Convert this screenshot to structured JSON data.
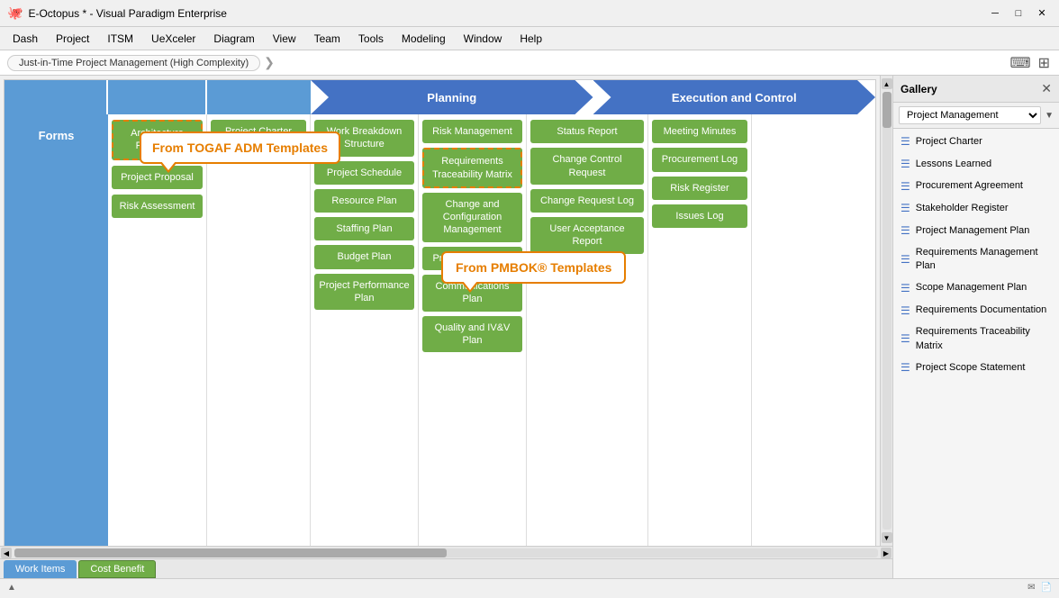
{
  "titleBar": {
    "title": "E-Octopus * - Visual Paradigm Enterprise",
    "icon": "🐙"
  },
  "menuBar": {
    "items": [
      "Dash",
      "Project",
      "ITSM",
      "UeXceler",
      "Diagram",
      "View",
      "Team",
      "Tools",
      "Modeling",
      "Window",
      "Help"
    ]
  },
  "breadcrumb": {
    "text": "Just-in-Time Project Management (High Complexity)",
    "arrow": "❯"
  },
  "callouts": {
    "togaf": "From TOGAF ADM Templates",
    "pmbok": "From PMBOK® Templates"
  },
  "headers": {
    "planning": "Planning",
    "execution": "Execution and Control"
  },
  "columns": {
    "forms": {
      "label": "Forms"
    },
    "togaf": {
      "cards": [
        "Architecture Principles",
        "Project Proposal",
        "Risk Assessment"
      ]
    },
    "initiation": {
      "cards": [
        "Project Charter"
      ]
    },
    "planning": {
      "col1": [
        "Work Breakdown Structure",
        "Project Schedule",
        "Resource Plan",
        "Staffing Plan",
        "Budget Plan",
        "Project Performance Plan"
      ],
      "col2": [
        "Risk Management",
        "Requirements Traceability Matrix",
        "Change and Configuration Management",
        "Procurement Plan",
        "Communications Plan",
        "Quality and IV&V Plan"
      ]
    },
    "executionLeft": {
      "cards": [
        "Status Report",
        "Change Control Request",
        "Change Request Log",
        "User Acceptance Report"
      ]
    },
    "executionMid": {
      "cards": [
        "Meeting Minutes",
        "Procurement Log",
        "Risk Register",
        "Issues Log"
      ]
    },
    "executionRight": {
      "cards": []
    }
  },
  "gallery": {
    "title": "Gallery",
    "closeBtn": "✕",
    "filter": "Project Management",
    "items": [
      "Project Charter",
      "Lessons Learned",
      "Procurement Agreement",
      "Stakeholder Register",
      "Project Management Plan",
      "Requirements Management Plan",
      "Scope Management Plan",
      "Requirements Documentation",
      "Requirements Traceability Matrix",
      "Project Scope Statement"
    ]
  },
  "tabs": {
    "workItems": "Work Items",
    "costBenefit": "Cost Benefit"
  },
  "statusBar": {
    "arrow": "▲"
  }
}
